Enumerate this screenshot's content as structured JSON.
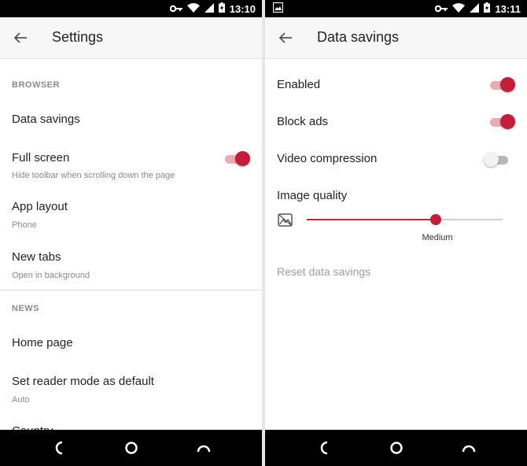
{
  "status": {
    "left_time": "13:10",
    "right_time": "13:11"
  },
  "left": {
    "title": "Settings",
    "sections": {
      "browser_header": "BROWSER",
      "news_header": "NEWS"
    },
    "items": {
      "data_savings": "Data savings",
      "full_screen": "Full screen",
      "full_screen_sub": "Hide toolbar when scrolling down the page",
      "app_layout": "App layout",
      "app_layout_sub": "Phone",
      "new_tabs": "New tabs",
      "new_tabs_sub": "Open in background",
      "home_page": "Home page",
      "reader_mode": "Set reader mode as default",
      "reader_mode_sub": "Auto",
      "country": "Country"
    },
    "toggles": {
      "full_screen": true
    }
  },
  "right": {
    "title": "Data savings",
    "items": {
      "enabled": "Enabled",
      "block_ads": "Block ads",
      "video_compression": "Video compression",
      "image_quality": "Image quality",
      "image_quality_value": "Medium",
      "reset": "Reset data savings"
    },
    "toggles": {
      "enabled": true,
      "block_ads": true,
      "video_compression": false
    },
    "slider": {
      "level": 0.66
    }
  },
  "colors": {
    "accent": "#c41e3a",
    "accent_track": "#ecaab4",
    "secondary_text": "#8a8a8a"
  }
}
